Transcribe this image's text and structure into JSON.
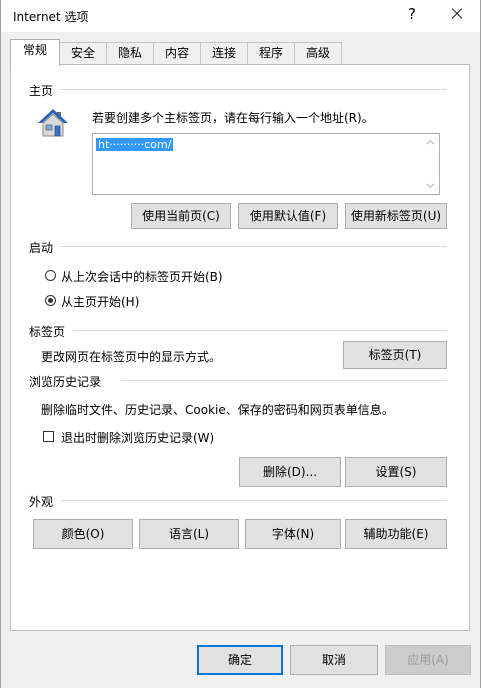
{
  "window": {
    "title": "Internet 选项",
    "help": "?"
  },
  "tabs": [
    {
      "label": "常规",
      "active": true
    },
    {
      "label": "安全"
    },
    {
      "label": "隐私"
    },
    {
      "label": "内容"
    },
    {
      "label": "连接"
    },
    {
      "label": "程序"
    },
    {
      "label": "高级"
    }
  ],
  "home": {
    "title": "主页",
    "description": "若要创建多个主标签页，请在每行输入一个地址(R)。",
    "address_value": "ht··········com/",
    "use_current": "使用当前页(C)",
    "use_default": "使用默认值(F)",
    "use_new_tab": "使用新标签页(U)"
  },
  "startup": {
    "title": "启动",
    "option_last_session": "从上次会话中的标签页开始(B)",
    "option_home": "从主页开始(H)",
    "selected": "option_home"
  },
  "tabs_section": {
    "title": "标签页",
    "description": "更改网页在标签页中的显示方式。",
    "button": "标签页(T)"
  },
  "history": {
    "title": "浏览历史记录",
    "description": "删除临时文件、历史记录、Cookie、保存的密码和网页表单信息。",
    "delete_on_exit": "退出时删除浏览历史记录(W)",
    "delete_on_exit_checked": false,
    "delete_button": "删除(D)...",
    "settings_button": "设置(S)"
  },
  "appearance": {
    "title": "外观",
    "colors": "颜色(O)",
    "languages": "语言(L)",
    "fonts": "字体(N)",
    "accessibility": "辅助功能(E)"
  },
  "footer": {
    "ok": "确定",
    "cancel": "取消",
    "apply": "应用(A)"
  },
  "colors": {
    "accent": "#0078d7",
    "selection": "#3399ff",
    "icon_house_blue": "#2b63b8"
  }
}
